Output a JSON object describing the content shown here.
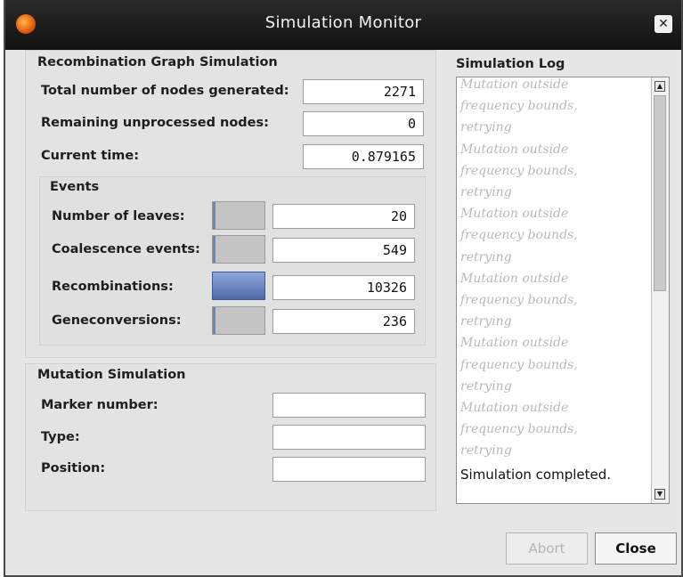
{
  "window": {
    "title": "Simulation Monitor"
  },
  "recombination": {
    "title": "Recombination Graph Simulation",
    "rows": [
      {
        "label": "Total number of nodes generated:",
        "value": "2271"
      },
      {
        "label": "Remaining unprocessed nodes:",
        "value": "0"
      },
      {
        "label": "Current time:",
        "value": "0.879165"
      }
    ],
    "events": {
      "title": "Events",
      "rows": [
        {
          "label": "Number of leaves:",
          "value": "20"
        },
        {
          "label": "Coalescence events:",
          "value": "549"
        },
        {
          "label": "Recombinations:",
          "value": "10326"
        },
        {
          "label": "Geneconversions:",
          "value": "236"
        }
      ]
    }
  },
  "mutation": {
    "title": "Mutation Simulation",
    "rows": [
      {
        "label": "Marker number:",
        "value": ""
      },
      {
        "label": "Type:",
        "value": ""
      },
      {
        "label": "Position:",
        "value": ""
      }
    ]
  },
  "log": {
    "title": "Simulation Log",
    "lines": [
      "Mutation outside",
      "frequency bounds,",
      "retrying",
      "Mutation outside",
      "frequency bounds,",
      "retrying",
      "Mutation outside",
      "frequency bounds,",
      "retrying",
      "Mutation outside",
      "frequency bounds,",
      "retrying",
      "Mutation outside",
      "frequency bounds,",
      "retrying",
      "Mutation outside",
      "frequency bounds,",
      "retrying"
    ],
    "final": "Simulation completed."
  },
  "buttons": {
    "abort": "Abort",
    "close": "Close"
  }
}
